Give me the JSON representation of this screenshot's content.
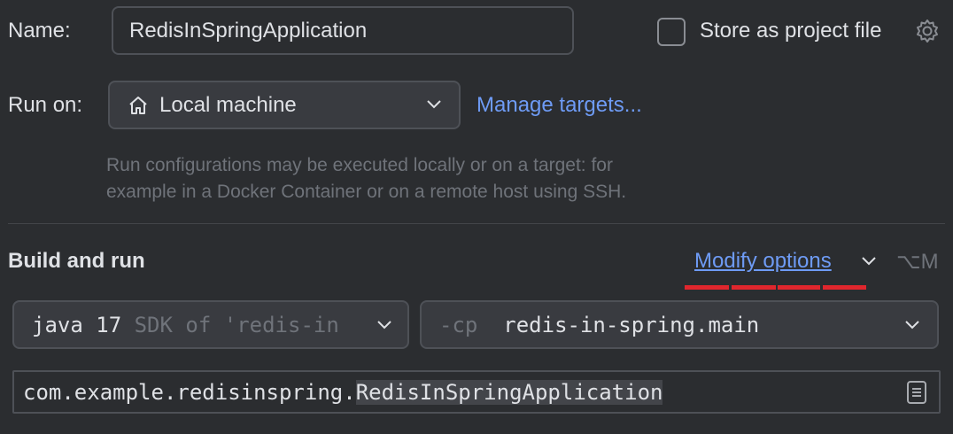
{
  "name": {
    "label": "Name:",
    "value": "RedisInSpringApplication"
  },
  "store": {
    "label": "Store as project file",
    "checked": false
  },
  "run_on": {
    "label": "Run on:",
    "target": "Local machine",
    "manage_link": "Manage targets...",
    "hint_line1": "Run configurations may be executed locally or on a target: for",
    "hint_line2": "example in a Docker Container or on a remote host using SSH."
  },
  "build": {
    "title": "Build and run",
    "modify_options": "Modify options",
    "shortcut": "⌥M",
    "sdk_main": "java 17",
    "sdk_dim": "SDK of 'redis-in",
    "cp_flag": "-cp",
    "cp_value": "redis-in-spring.main",
    "main_class_pkg": "com.example.redisinspring.",
    "main_class_name": "RedisInSpringApplication"
  },
  "colors": {
    "background": "#2b2d30",
    "link": "#6e9bf5",
    "annotation_red": "#e0262d"
  }
}
